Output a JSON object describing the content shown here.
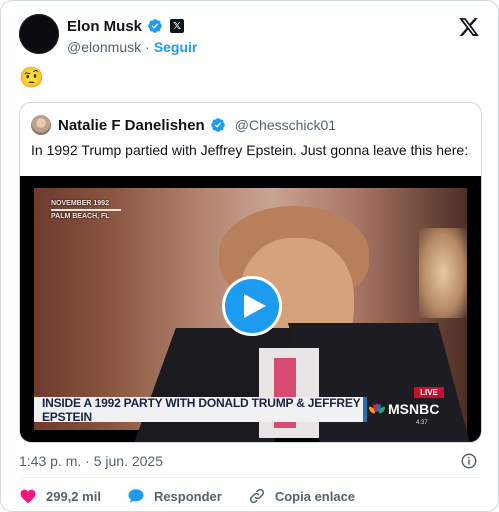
{
  "author": {
    "name": "Elon Musk",
    "handle": "@elonmusk",
    "separator": "·",
    "follow_label": "Seguir"
  },
  "tweet": {
    "emoji": "🤨"
  },
  "quoted": {
    "name": "Natalie F Danelishen",
    "handle": "@Chesschick01",
    "text": "In 1992 Trump partied with Jeffrey Epstein. Just gonna leave this here:",
    "video": {
      "date_line1": "NOVEMBER 1992",
      "date_line2": "PALM BEACH, FL",
      "lower_third": "INSIDE A 1992 PARTY WITH DONALD TRUMP & JEFFREY EPSTEIN",
      "live_label": "LIVE",
      "network": "MSNBC",
      "clock": "4:37"
    }
  },
  "footer": {
    "timestamp": "1:43 p. m. · 5 jun. 2025",
    "likes_count": "299,2 mil",
    "reply_label": "Responder",
    "copy_link_label": "Copia enlace"
  },
  "colors": {
    "accent": "#1d9bf0",
    "like": "#f91880",
    "text": "#0f1419",
    "muted": "#536471"
  }
}
